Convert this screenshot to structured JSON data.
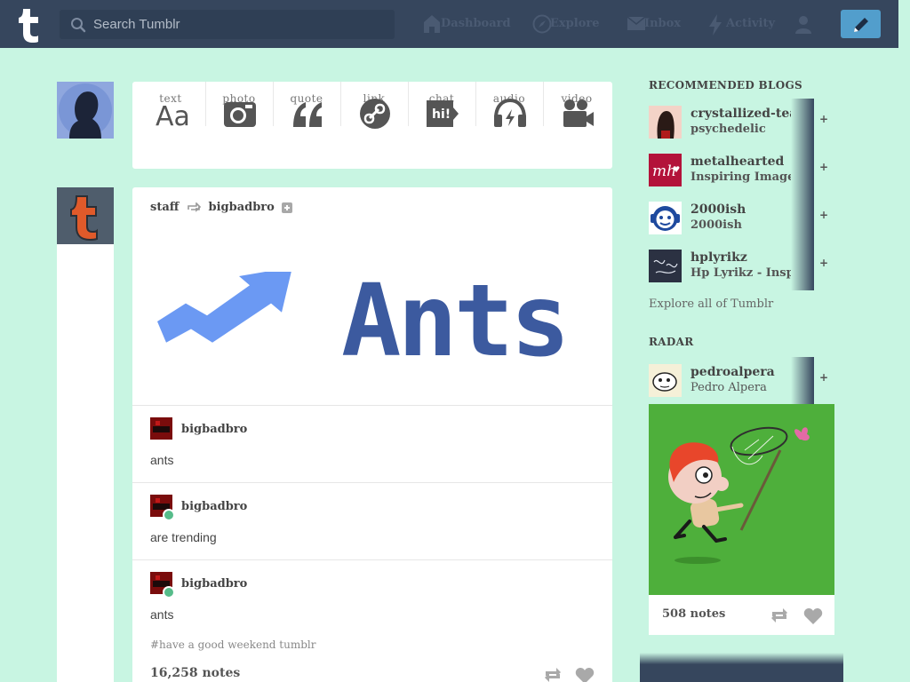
{
  "header": {
    "search_placeholder": "Search Tumblr",
    "nav": [
      {
        "id": "dashboard",
        "label": "Dashboard",
        "icon": "home-icon"
      },
      {
        "id": "explore",
        "label": "Explore",
        "icon": "compass-icon"
      },
      {
        "id": "inbox",
        "label": "Inbox",
        "icon": "envelope-icon"
      },
      {
        "id": "activity",
        "label": "Activity",
        "icon": "lightning-icon"
      },
      {
        "id": "account",
        "label": "",
        "icon": "user-icon"
      }
    ],
    "compose_icon": "pencil-icon",
    "colors": {
      "bar": "#36465d",
      "compose": "#529ecc",
      "background": "#c8f5e2"
    }
  },
  "post_form": {
    "items": [
      {
        "label": "text",
        "icon": "text-aa-icon"
      },
      {
        "label": "photo",
        "icon": "camera-icon"
      },
      {
        "label": "quote",
        "icon": "quote-icon"
      },
      {
        "label": "link",
        "icon": "link-icon"
      },
      {
        "label": "chat",
        "icon": "chat-bubble-icon"
      },
      {
        "label": "audio",
        "icon": "headphones-icon"
      },
      {
        "label": "video",
        "icon": "video-camera-icon"
      }
    ]
  },
  "post": {
    "author": "staff",
    "reblogged_from": "bigbadbro",
    "hero_text": "Ants",
    "reblogs": [
      {
        "name": "bigbadbro",
        "text": "ants"
      },
      {
        "name": "bigbadbro",
        "text": "are trending"
      },
      {
        "name": "bigbadbro",
        "text": "ants"
      }
    ],
    "tags": "#have a good weekend tumblr",
    "notes": "16,258 notes"
  },
  "sidebar": {
    "recommended_title": "RECOMMENDED BLOGS",
    "recommended": [
      {
        "name": "crystallized-tears",
        "subtitle": "psychedelic"
      },
      {
        "name": "metalhearted",
        "subtitle": "Inspiring Images,"
      },
      {
        "name": "2000ish",
        "subtitle": "2000ish"
      },
      {
        "name": "hplyrikz",
        "subtitle": "Hp Lyrikz - Inspiring"
      }
    ],
    "follow_label": "+",
    "explore_label": "Explore all of Tumblr",
    "radar_title": "RADAR",
    "radar": {
      "name": "pedroalpera",
      "subtitle": "Pedro Alpera",
      "notes": "508 notes"
    }
  }
}
